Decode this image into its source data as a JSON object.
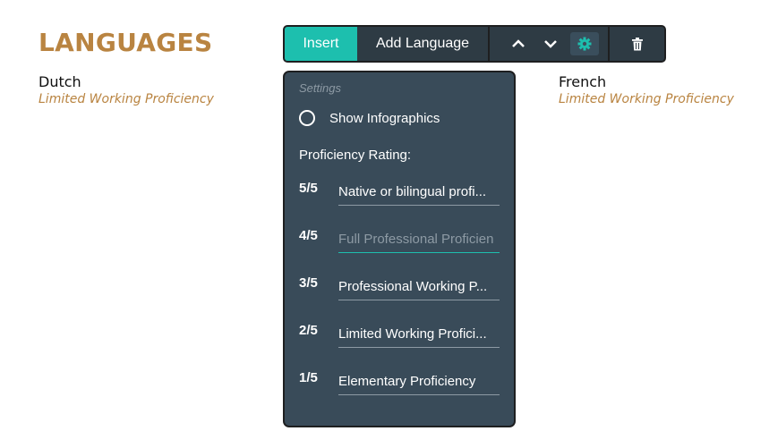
{
  "section": {
    "title": "LANGUAGES"
  },
  "languages": [
    {
      "name": "Dutch",
      "level": "Limited Working Proficiency"
    },
    {
      "name": "French",
      "level": "Limited Working Proficiency"
    }
  ],
  "toolbar": {
    "insert_label": "Insert",
    "add_label": "Add Language",
    "icons": {
      "up": "chevron-up-icon",
      "down": "chevron-down-icon",
      "settings": "gear-icon",
      "delete": "trash-icon"
    }
  },
  "settings": {
    "header": "Settings",
    "show_infographics_label": "Show Infographics",
    "show_infographics_checked": false,
    "rating_label": "Proficiency Rating:",
    "ratings": [
      {
        "score": "5/5",
        "value": "Native or bilingual profi...",
        "placeholder": ""
      },
      {
        "score": "4/5",
        "value": "",
        "placeholder": "Full Professional Proficien"
      },
      {
        "score": "3/5",
        "value": "Professional Working P...",
        "placeholder": ""
      },
      {
        "score": "2/5",
        "value": "Limited Working Profici...",
        "placeholder": ""
      },
      {
        "score": "1/5",
        "value": "Elementary Proficiency",
        "placeholder": ""
      }
    ]
  },
  "colors": {
    "accent": "#1dbfae",
    "heading": "#b98441",
    "panel": "#394b59",
    "toolbar": "#2e3b44"
  }
}
